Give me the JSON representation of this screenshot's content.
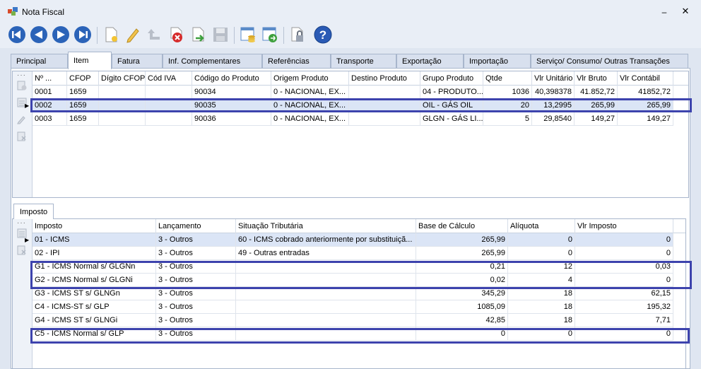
{
  "window": {
    "title": "Nota Fiscal",
    "minimize": "–",
    "close": "✕"
  },
  "toolbar": {
    "buttons": [
      "first-record",
      "previous-record",
      "next-record",
      "last-record",
      "new-record",
      "edit-record",
      "undo",
      "delete-record",
      "confirm",
      "save",
      "calculate",
      "export",
      "lock",
      "help"
    ],
    "help_label": "?"
  },
  "tabs": [
    "Principal",
    "Item",
    "Fatura",
    "Inf. Complementares",
    "Referências",
    "Transporte",
    "Exportação",
    "Importação",
    "Serviço/ Consumo/ Outras Transações"
  ],
  "items_grid": {
    "columns": [
      "Nº ...",
      "CFOP",
      "Dígito CFOP",
      "Cód IVA",
      "Código do Produto",
      "Origem Produto",
      "Destino Produto",
      "Grupo Produto",
      "Qtde",
      "Vlr Unitário",
      "Vlr Bruto",
      "Vlr Contábil"
    ],
    "sort_indicator": "▲",
    "rows": [
      [
        "0001",
        "1659",
        "",
        "",
        "90034",
        "0 - NACIONAL, EX...",
        "",
        "04 - PRODUTO...",
        "1036",
        "40,398378",
        "41.852,72",
        "41852,72"
      ],
      [
        "0002",
        "1659",
        "",
        "",
        "90035",
        "0 - NACIONAL, EX...",
        "",
        "OIL - GÁS OIL",
        "20",
        "13,2995",
        "265,99",
        "265,99"
      ],
      [
        "0003",
        "1659",
        "",
        "",
        "90036",
        "0 - NACIONAL, EX...",
        "",
        "GLGN - GÁS LI...",
        "5",
        "29,8540",
        "149,27",
        "149,27"
      ]
    ],
    "selected_row": 1
  },
  "sub_tab": "Imposto",
  "tax_grid": {
    "columns": [
      "Imposto",
      "Lançamento",
      "Situação Tributária",
      "Base de Cálculo",
      "Alíquota",
      "Vlr Imposto"
    ],
    "rows": [
      [
        "01 - ICMS",
        "3 - Outros",
        "60 - ICMS cobrado anteriormente por substituiçã...",
        "265,99",
        "0",
        "0"
      ],
      [
        "02 - IPI",
        "3 - Outros",
        "49 - Outras entradas",
        "265,99",
        "0",
        "0"
      ],
      [
        "G1 - ICMS Normal s/ GLGNn",
        "3 - Outros",
        "",
        "0,21",
        "12",
        "0,03"
      ],
      [
        "G2 - ICMS Normal s/ GLGNi",
        "3 - Outros",
        "",
        "0,02",
        "4",
        "0"
      ],
      [
        "G3 - ICMS ST s/ GLNGn",
        "3 - Outros",
        "",
        "345,29",
        "18",
        "62,15"
      ],
      [
        "C4 - ICMS-ST s/ GLP",
        "3 - Outros",
        "",
        "1085,09",
        "18",
        "195,32"
      ],
      [
        "G4 - ICMS ST s/ GLNGi",
        "3 - Outros",
        "",
        "42,85",
        "18",
        "7,71"
      ],
      [
        "C5 - ICMS Normal s/ GLP",
        "3 - Outros",
        "",
        "0",
        "0",
        "0"
      ]
    ],
    "selected_row": 0
  },
  "colors": {
    "highlight": "#3d43ad",
    "selected_row": "#dbe5f6",
    "panel_bg": "#dfe6f1"
  }
}
